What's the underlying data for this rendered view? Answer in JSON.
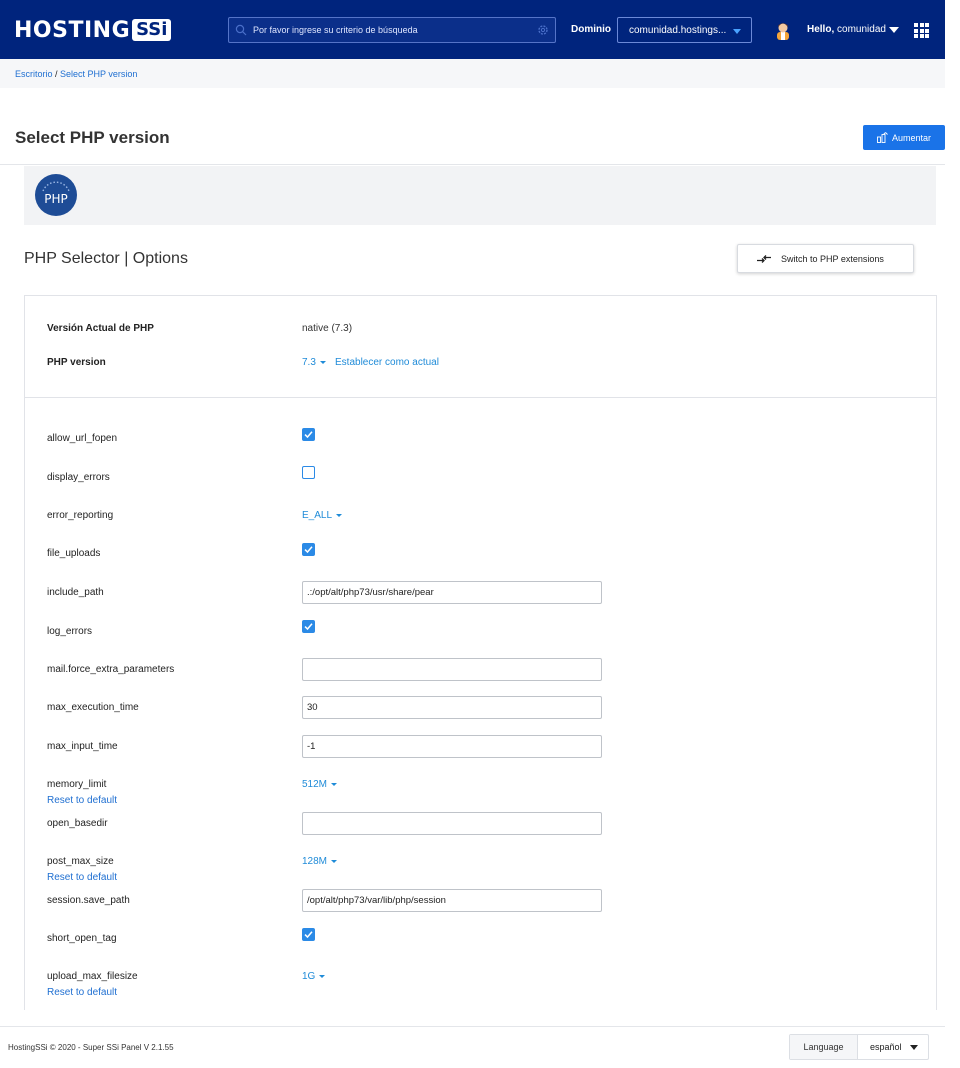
{
  "header": {
    "logo_text": "HOSTING",
    "logo_badge": "SSi",
    "search_placeholder": "Por favor ingrese su criterio de búsqueda",
    "domain_label": "Dominio",
    "domain_value": "comunidad.hostings...",
    "greeting": "Hello,",
    "username": "comunidad",
    "icons": [
      "search-icon",
      "gear-icon",
      "chevron-down-icon",
      "avatar",
      "apps-grid-icon"
    ],
    "bg_color": "#00247d"
  },
  "breadcrumb": {
    "home": "Escritorio",
    "separator": " / ",
    "current": "Select PHP version"
  },
  "page": {
    "title": "Select PHP version",
    "upgrade_button": "Aumentar",
    "banner_logo": "PHP",
    "selector_title": "PHP Selector | Options",
    "switch_button": "Switch to PHP extensions"
  },
  "version": {
    "current_label": "Versión Actual de PHP",
    "current_value": "native (7.3)",
    "php_version_label": "PHP version",
    "php_version_value": "7.3",
    "set_current": "Establecer como actual"
  },
  "options": {
    "allow_url_fopen": {
      "label": "allow_url_fopen",
      "checked": true
    },
    "display_errors": {
      "label": "display_errors",
      "checked": false
    },
    "error_reporting": {
      "label": "error_reporting",
      "value": "E_ALL"
    },
    "file_uploads": {
      "label": "file_uploads",
      "checked": true
    },
    "include_path": {
      "label": "include_path",
      "value": ".:/opt/alt/php73/usr/share/pear"
    },
    "log_errors": {
      "label": "log_errors",
      "checked": true
    },
    "mail_force_extra_parameters": {
      "label": "mail.force_extra_parameters",
      "value": ""
    },
    "max_execution_time": {
      "label": "max_execution_time",
      "value": "30"
    },
    "max_input_time": {
      "label": "max_input_time",
      "value": "-1"
    },
    "memory_limit": {
      "label": "memory_limit",
      "value": "512M",
      "reset": "Reset to default"
    },
    "open_basedir": {
      "label": "open_basedir",
      "value": ""
    },
    "post_max_size": {
      "label": "post_max_size",
      "value": "128M",
      "reset": "Reset to default"
    },
    "session_save_path": {
      "label": "session.save_path",
      "value": "/opt/alt/php73/var/lib/php/session"
    },
    "short_open_tag": {
      "label": "short_open_tag",
      "checked": true
    },
    "upload_max_filesize": {
      "label": "upload_max_filesize",
      "value": "1G",
      "reset": "Reset to default"
    }
  },
  "footer": {
    "copyright": "HostingSSi © 2020 - Super SSi Panel V 2.1.55",
    "language_label": "Language",
    "language_value": "español"
  },
  "colors": {
    "accent": "#1a73e8",
    "link": "#1f8bd8",
    "checkbox": "#2b8ae6"
  }
}
